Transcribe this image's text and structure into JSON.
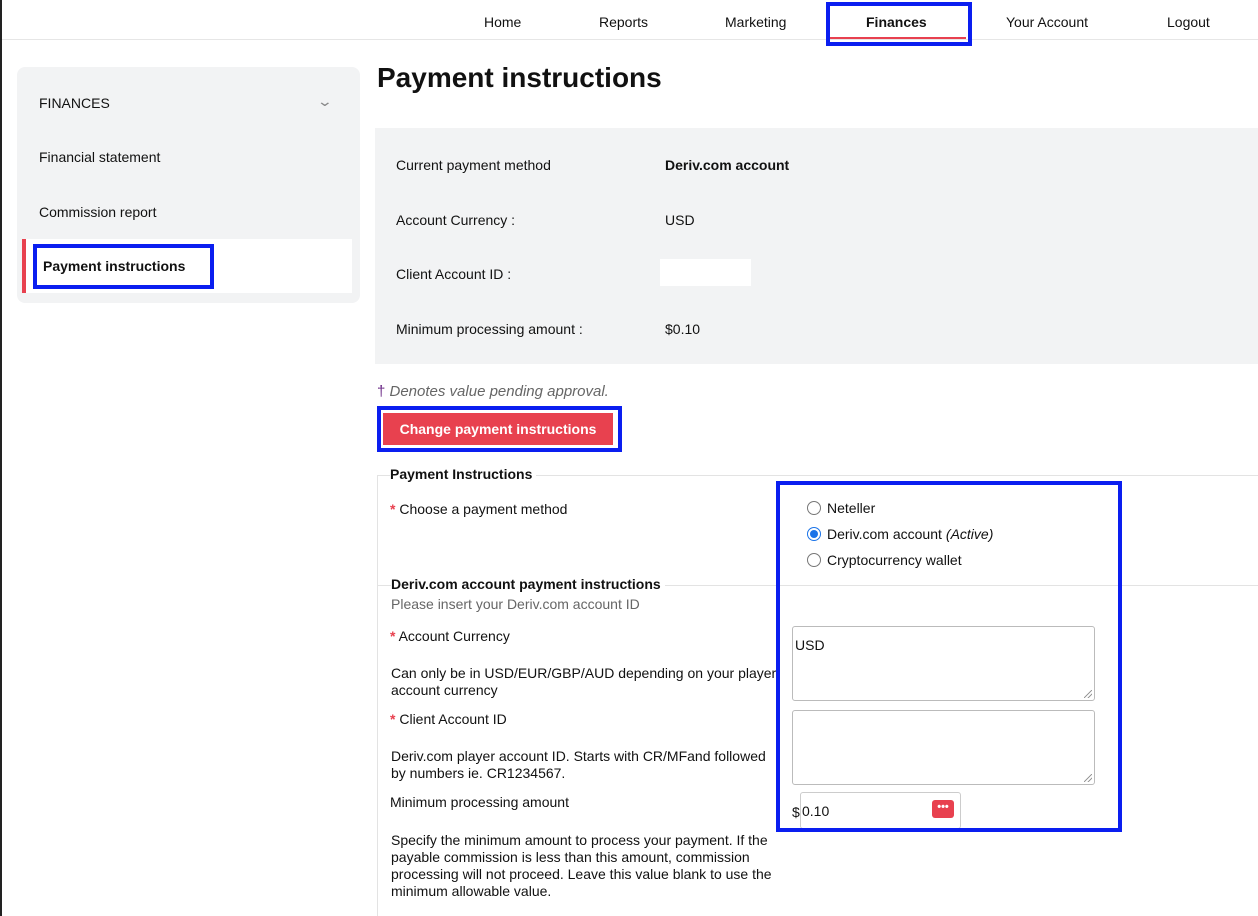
{
  "nav": {
    "items": [
      "Home",
      "Reports",
      "Marketing",
      "Finances",
      "Your Account",
      "Logout"
    ],
    "active": "Finances"
  },
  "sidebar": {
    "title": "FINANCES",
    "items": [
      "Financial statement",
      "Commission report",
      "Payment instructions"
    ],
    "active": "Payment instructions"
  },
  "page": {
    "title": "Payment instructions"
  },
  "summary": {
    "rows": [
      {
        "label": "Current payment method",
        "value": "Deriv.com account"
      },
      {
        "label": "Account Currency :",
        "value": "USD"
      },
      {
        "label": "Client Account ID :",
        "value": ""
      },
      {
        "label": "Minimum processing amount :",
        "value": "$0.10"
      }
    ]
  },
  "pending_note": {
    "dagger": "†",
    "text": " Denotes value pending approval."
  },
  "change_button": "Change payment instructions",
  "form": {
    "legend": "Payment Instructions",
    "method_label": "Choose a payment method",
    "methods": [
      {
        "label": "Neteller",
        "checked": false,
        "tag": ""
      },
      {
        "label": "Deriv.com account",
        "checked": true,
        "tag": "(Active)"
      },
      {
        "label": "Cryptocurrency wallet",
        "checked": false,
        "tag": ""
      }
    ],
    "section_title": "Deriv.com account payment instructions",
    "section_note": "Please insert your Deriv.com account ID",
    "currency_label": "Account Currency",
    "currency_help": "Can only be in USD/EUR/GBP/AUD depending on your player account currency",
    "currency_value": "USD",
    "client_id_label": "Client Account ID",
    "client_id_help": "Deriv.com player account ID. Starts with CR/MFand followed by numbers ie. CR1234567.",
    "client_id_value": "",
    "min_label": "Minimum processing amount",
    "min_help": "Specify the minimum amount to process your payment. If the payable commission is less than this amount, commission processing will not proceed. Leave this value blank to use the minimum allowable value.",
    "min_currency": "$",
    "min_value": "0.10",
    "required_mark": "*"
  },
  "colors": {
    "accent": "#e8414f",
    "highlight": "#0a1ef0",
    "panel": "#f2f3f4"
  }
}
